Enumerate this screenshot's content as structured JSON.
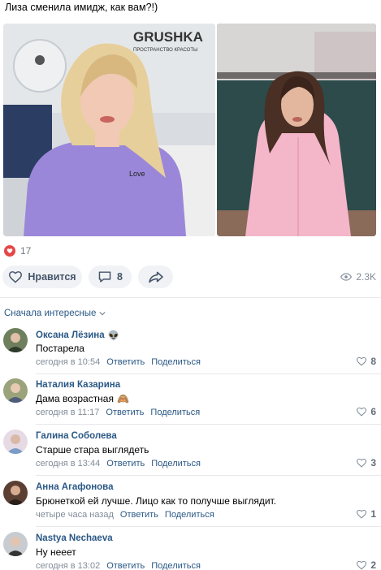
{
  "post": {
    "text": "Лиза сменила имидж, как вам?!)",
    "photo_left_sign": "GRUSHKA",
    "photo_left_sign_sub": "ПРОСТРАНСТВО КРАСОТЫ",
    "photo_left_tshirt": "Love"
  },
  "reactions": {
    "count": "17",
    "icon": "heart-icon",
    "color": "#e64646"
  },
  "actions": {
    "like_label": "Нравится",
    "comment_count": "8",
    "views": "2.3K"
  },
  "comments_sort": "Сначала интересные",
  "comments": [
    {
      "name": "Оксана Лёзина",
      "badge": "👽",
      "text": "Постарела",
      "emoji": "",
      "time": "сегодня в 10:54",
      "reply": "Ответить",
      "share": "Поделиться",
      "likes": "8",
      "avatar_color": "#7a8a6a"
    },
    {
      "name": "Наталия Казарина",
      "badge": "",
      "text": "Дама возрастная",
      "emoji": "🙈",
      "time": "сегодня в 11:17",
      "reply": "Ответить",
      "share": "Поделиться",
      "likes": "6",
      "avatar_color": "#8f9b6e"
    },
    {
      "name": "Галина Соболева",
      "badge": "",
      "text": "Старше стара выглядеть",
      "emoji": "",
      "time": "сегодня в 13:44",
      "reply": "Ответить",
      "share": "Поделиться",
      "likes": "3",
      "avatar_color": "#c9b7c6"
    },
    {
      "name": "Анна Агафонова",
      "badge": "",
      "text": "Брюнеткой ей лучше. Лицо как то получше выглядит.",
      "emoji": "",
      "time": "четыре часа назад",
      "reply": "Ответить",
      "share": "Поделиться",
      "likes": "1",
      "avatar_color": "#6b4a3a"
    },
    {
      "name": "Nastya Nechaeva",
      "badge": "",
      "text": "Ну нееет",
      "emoji": "",
      "time": "сегодня в 13:02",
      "reply": "Ответить",
      "share": "Поделиться",
      "likes": "2",
      "avatar_color": "#9aa0a6"
    }
  ]
}
